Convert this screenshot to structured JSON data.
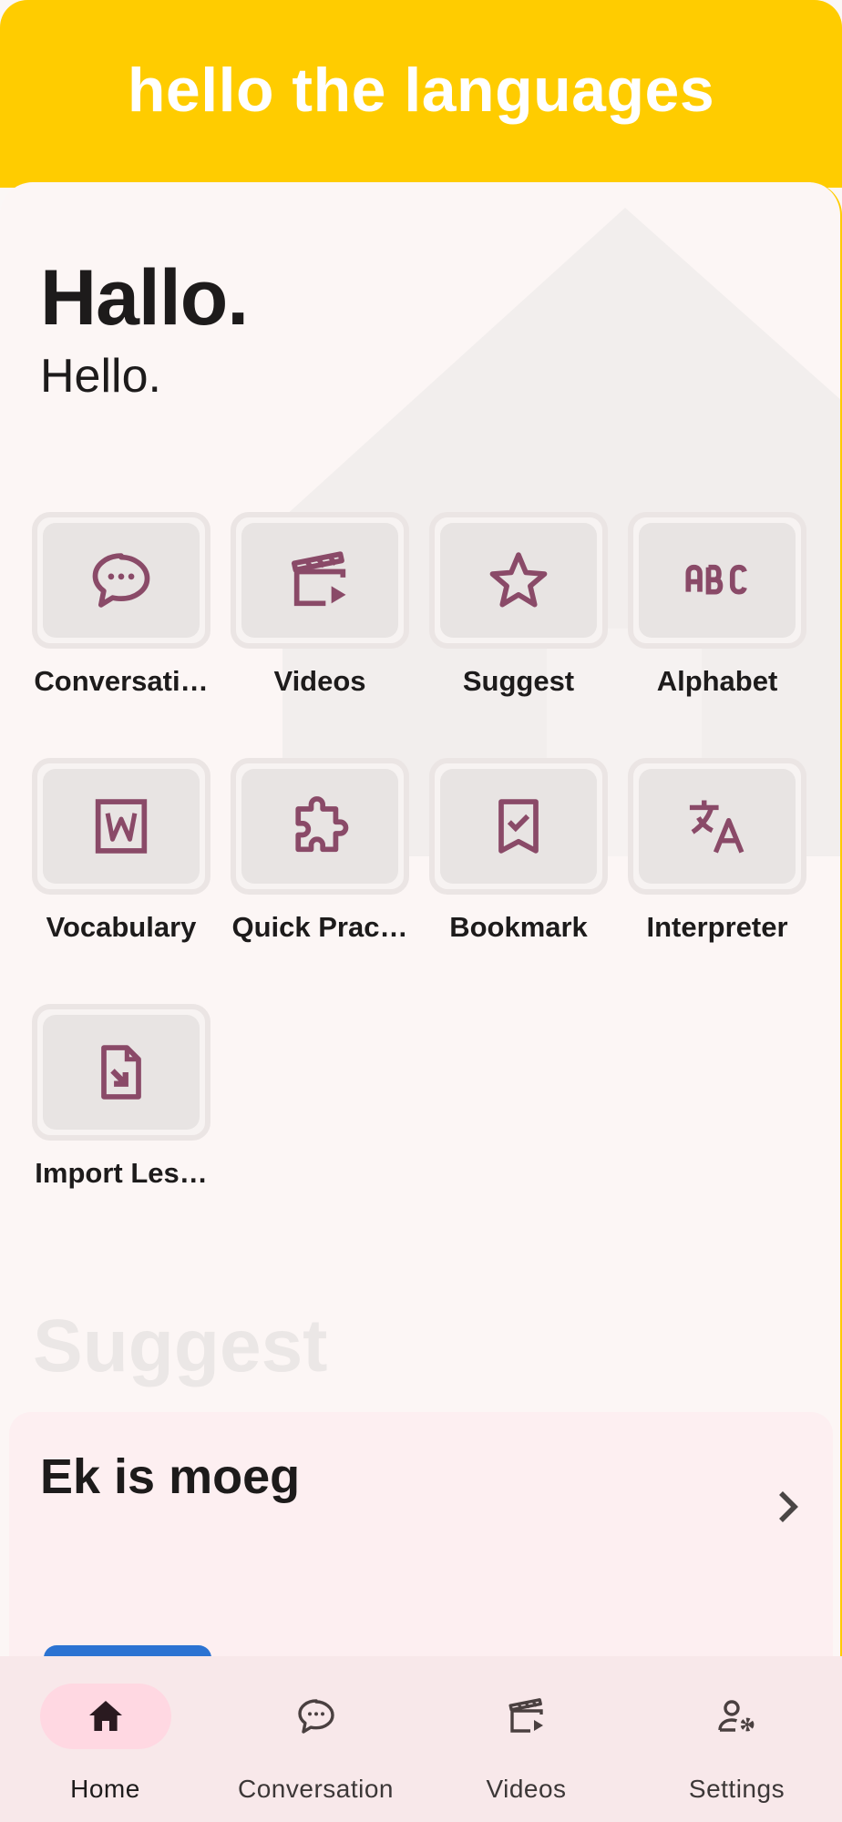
{
  "app": {
    "title": "hello the languages"
  },
  "colors": {
    "header": "#ffcc00",
    "accent": "#8a4a68",
    "background": "#fcf6f5",
    "nav_background": "#f8e8ea",
    "nav_active_pill": "#ffd8e2"
  },
  "greeting": {
    "phrase": "Hallo.",
    "translation": "Hello."
  },
  "features": [
    {
      "label": "Conversati…",
      "icon": "chat-bubble-icon"
    },
    {
      "label": "Videos",
      "icon": "clapperboard-icon"
    },
    {
      "label": "Suggest",
      "icon": "star-icon"
    },
    {
      "label": "Alphabet",
      "icon": "abc-icon"
    },
    {
      "label": "Vocabulary",
      "icon": "word-document-icon"
    },
    {
      "label": "Quick Prac…",
      "icon": "puzzle-piece-icon"
    },
    {
      "label": "Bookmark",
      "icon": "bookmark-check-icon"
    },
    {
      "label": "Interpreter",
      "icon": "translate-icon"
    },
    {
      "label": "Import Les…",
      "icon": "file-import-icon"
    }
  ],
  "suggest": {
    "heading": "Suggest",
    "phrase": "Ek is moeg"
  },
  "nav": {
    "items": [
      {
        "label": "Home",
        "icon": "home-icon",
        "active": true
      },
      {
        "label": "Conversation",
        "icon": "chat-bubble-icon",
        "active": false
      },
      {
        "label": "Videos",
        "icon": "clapperboard-icon",
        "active": false
      },
      {
        "label": "Settings",
        "icon": "user-settings-icon",
        "active": false
      }
    ]
  }
}
